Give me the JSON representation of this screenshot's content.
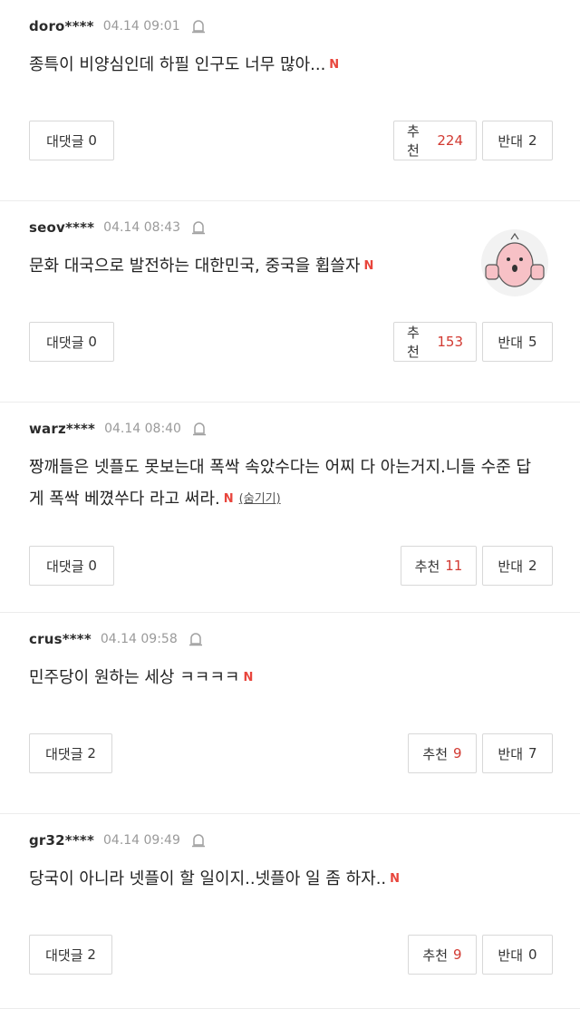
{
  "comments": [
    {
      "user": "doro****",
      "date": "04.14 09:01",
      "text": "종특이 비양심인데 하필 인구도 너무 많아...",
      "badge": "N",
      "reply_label": "대댓글",
      "reply_count": "0",
      "rec_label": "추천",
      "rec_count": "224",
      "opp_label": "반대",
      "opp_count": "2"
    },
    {
      "user": "seov****",
      "date": "04.14 08:43",
      "text": "문화 대국으로 발전하는 대한민국, 중국을 휩쓸자",
      "badge": "N",
      "reply_label": "대댓글",
      "reply_count": "0",
      "rec_label": "추천",
      "rec_count": "153",
      "opp_label": "반대",
      "opp_count": "5"
    },
    {
      "user": "warz****",
      "date": "04.14 08:40",
      "text": "짱깨들은 넷플도 못보는대 폭싹 속았수다는 어찌 다 아는거지.니들 수준 답게 폭싹 베꼈쑤다 라고 써라.",
      "badge": "N",
      "hide_label": "(숨기기)",
      "reply_label": "대댓글",
      "reply_count": "0",
      "rec_label": "추천",
      "rec_count": "11",
      "opp_label": "반대",
      "opp_count": "2"
    },
    {
      "user": "crus****",
      "date": "04.14 09:58",
      "text": "민주당이 원하는 세상 ㅋㅋㅋㅋ",
      "badge": "N",
      "reply_label": "대댓글",
      "reply_count": "2",
      "rec_label": "추천",
      "rec_count": "9",
      "opp_label": "반대",
      "opp_count": "7"
    },
    {
      "user": "gr32****",
      "date": "04.14 09:49",
      "text": "당국이 아니라 넷플이 할 일이지..넷플아 일 좀 하자..",
      "badge": "N",
      "reply_label": "대댓글",
      "reply_count": "2",
      "rec_label": "추천",
      "rec_count": "9",
      "opp_label": "반대",
      "opp_count": "0"
    }
  ],
  "colors": {
    "rec_count": "#d23a32",
    "badge": "#e8453c",
    "date": "#9a9a9a",
    "border": "#d8d8d8"
  },
  "icons": {
    "report": "bell-report-icon",
    "avatar": "thumbs-up-character-sticker"
  }
}
